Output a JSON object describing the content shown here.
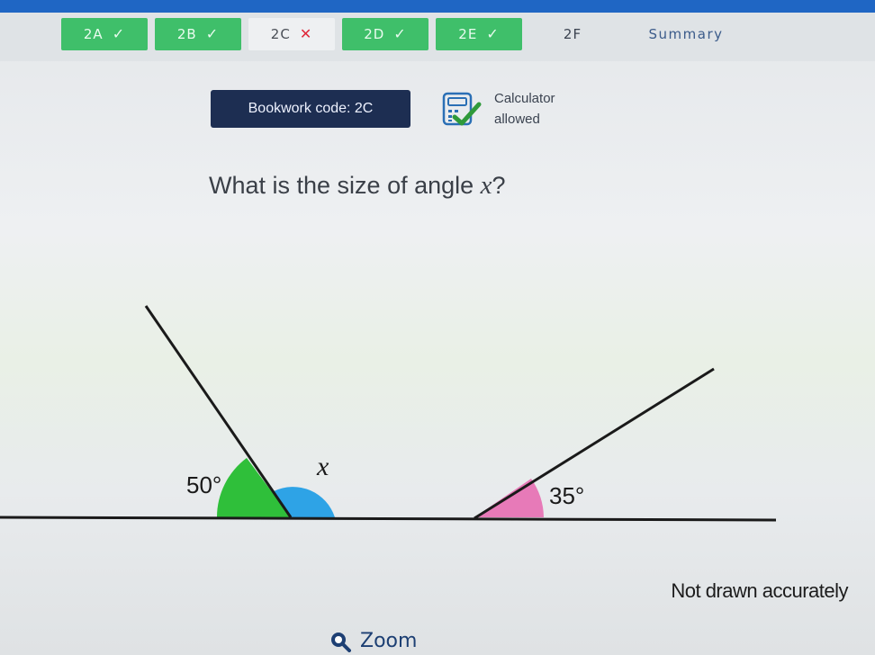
{
  "tabs": [
    {
      "label": "2A",
      "state": "correct",
      "mark": "✓"
    },
    {
      "label": "2B",
      "state": "correct",
      "mark": "✓"
    },
    {
      "label": "2C",
      "state": "incorrect",
      "mark": "✕"
    },
    {
      "label": "2D",
      "state": "correct",
      "mark": "✓"
    },
    {
      "label": "2E",
      "state": "correct",
      "mark": "✓"
    },
    {
      "label": "2F",
      "state": "unanswered",
      "mark": ""
    },
    {
      "label": "Summary",
      "state": "link",
      "mark": ""
    }
  ],
  "bookwork": {
    "label": "Bookwork code: 2C"
  },
  "calculator": {
    "line1": "Calculator",
    "line2": "allowed"
  },
  "question": {
    "prefix": "What is the size of angle ",
    "variable": "x",
    "suffix": "?"
  },
  "diagram": {
    "angle_left": "50°",
    "angle_unknown": "x",
    "angle_right": "35°"
  },
  "note": "Not drawn accurately",
  "zoom": {
    "label": "Zoom"
  },
  "colors": {
    "tab_done": "#3fbf6a",
    "bookwork_bg": "#1d2e52",
    "angle_green": "#2fbf3a",
    "angle_blue": "#2ea3e6",
    "angle_pink": "#e77ab8",
    "zoom_text": "#1d3f73"
  }
}
